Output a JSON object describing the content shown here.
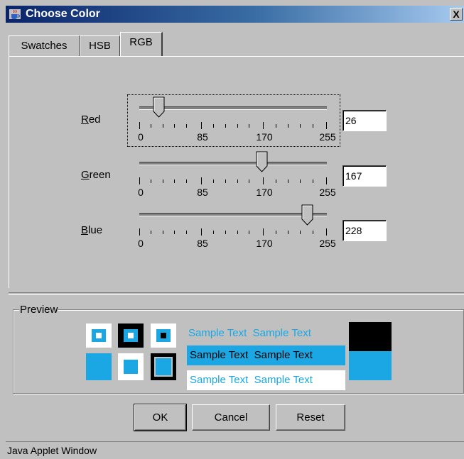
{
  "window": {
    "title": "Choose Color",
    "close_glyph": "X",
    "status_text": "Java Applet Window"
  },
  "tabs": [
    {
      "label": "Swatches",
      "active": false
    },
    {
      "label": "HSB",
      "active": false
    },
    {
      "label": "RGB",
      "active": true
    }
  ],
  "sliders": {
    "scale_labels": [
      "0",
      "85",
      "170",
      "255"
    ],
    "red": {
      "label_first": "R",
      "label_rest": "ed",
      "value": "26"
    },
    "green": {
      "label_first": "G",
      "label_rest": "reen",
      "value": "167"
    },
    "blue": {
      "label_first": "B",
      "label_rest": "lue",
      "value": "228"
    }
  },
  "preview": {
    "title": "Preview",
    "sample_text": "Sample Text",
    "selected_color": "#1aa7e4"
  },
  "buttons": {
    "ok": "OK",
    "cancel": "Cancel",
    "reset": "Reset"
  }
}
